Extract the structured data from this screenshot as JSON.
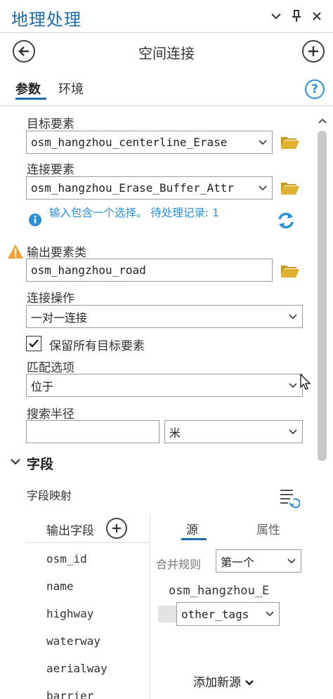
{
  "pane": {
    "title": "地理处理"
  },
  "tool": {
    "title": "空间连接"
  },
  "tabs": {
    "parameters": "参数",
    "environments": "环境"
  },
  "params": {
    "target_label": "目标要素",
    "target_value": "osm_hangzhou_centerline_Erase",
    "join_label": "连接要素",
    "join_value": "osm_hangzhou_Erase_Buffer_Attr",
    "info_text": "输入包含一个选择。 待处理记录: 1",
    "output_label": "输出要素类",
    "output_value": "osm_hangzhou_road",
    "operation_label": "连接操作",
    "operation_value": "一对一连接",
    "keep_all_label": "保留所有目标要素",
    "keep_all_checked": true,
    "match_label": "匹配选项",
    "match_value": "位于",
    "radius_label": "搜索半径",
    "radius_value": "",
    "radius_unit": "米"
  },
  "fields": {
    "section_title": "字段",
    "mapping_label": "字段映射",
    "output_fields_header": "输出字段",
    "source_tab": "源",
    "properties_tab": "属性",
    "output_fields": [
      "osm_id",
      "name",
      "highway",
      "waterway",
      "aerialway",
      "barrier"
    ],
    "merge_rule_label": "合并规则",
    "merge_rule_value": "第一个",
    "source_name": "osm_hangzhou_E",
    "source_field": "other_tags",
    "add_source": "添加新源"
  },
  "colors": {
    "accent": "#1f6cb0",
    "info": "#2b8fd6",
    "folder": "#e0b12e",
    "warning": "#f0a030"
  }
}
